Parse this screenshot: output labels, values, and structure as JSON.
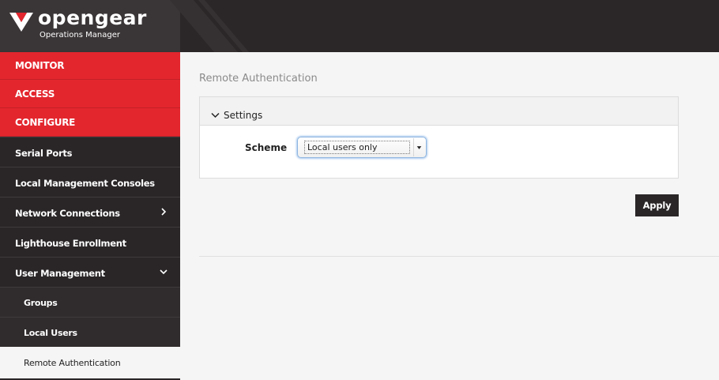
{
  "brand": {
    "name": "opengear",
    "subtitle": "Operations Manager"
  },
  "sidebar": {
    "sections": [
      {
        "label": "MONITOR"
      },
      {
        "label": "ACCESS"
      },
      {
        "label": "CONFIGURE"
      }
    ],
    "items": [
      {
        "label": "Serial Ports"
      },
      {
        "label": "Local Management Consoles"
      },
      {
        "label": "Network Connections",
        "icon": "chevron-right-icon"
      },
      {
        "label": "Lighthouse Enrollment"
      },
      {
        "label": "User Management",
        "icon": "chevron-down-icon"
      }
    ],
    "subitems": [
      {
        "label": "Groups"
      },
      {
        "label": "Local Users"
      },
      {
        "label": "Remote Authentication",
        "active": true
      }
    ]
  },
  "main": {
    "title": "Remote Authentication",
    "panel": {
      "heading": "Settings",
      "scheme_label": "Scheme",
      "scheme_value": "Local users only"
    },
    "apply_label": "Apply"
  },
  "colors": {
    "accent": "#e3262e",
    "sidebar_bg": "#2a2627",
    "topbar_bg": "#2b2627"
  }
}
